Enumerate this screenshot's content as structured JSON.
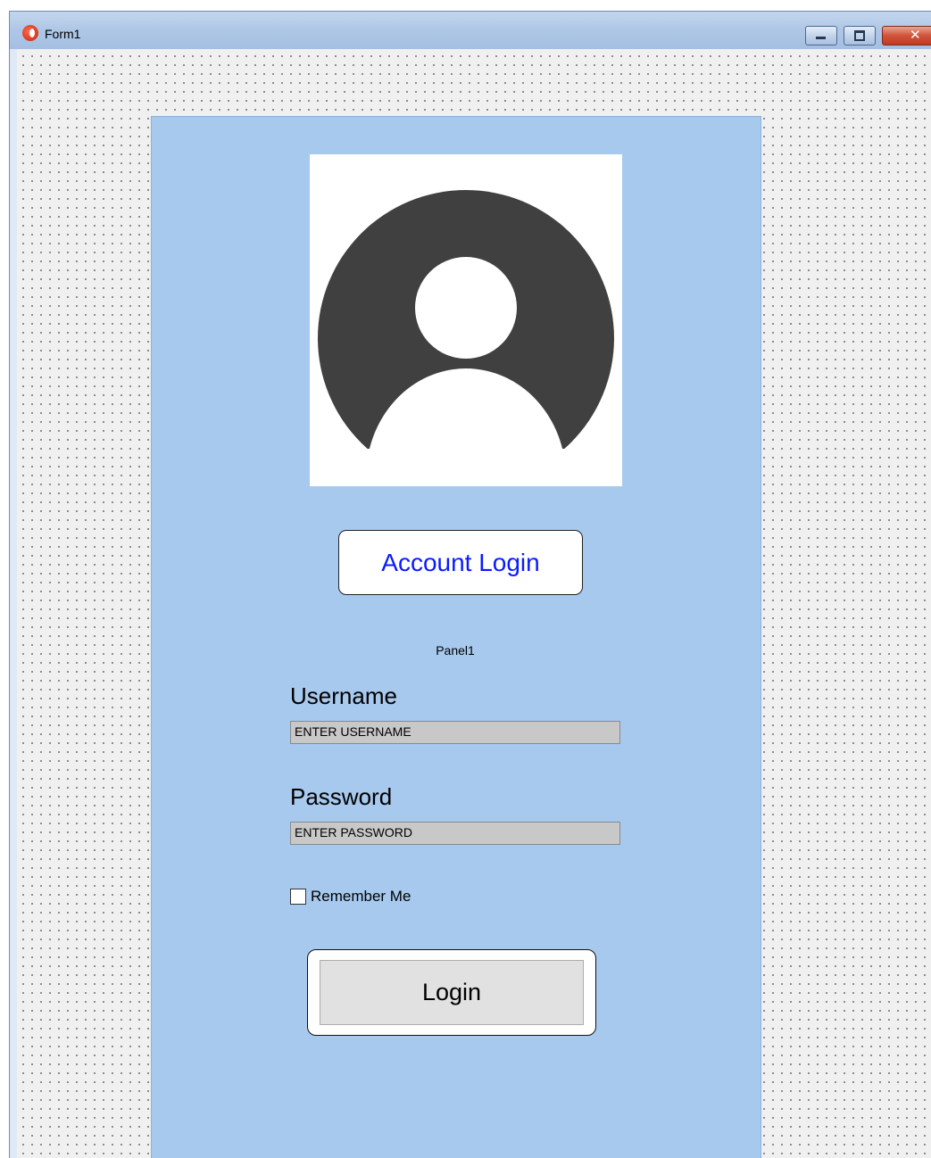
{
  "window": {
    "title": "Form1",
    "controls": [
      "minimize",
      "maximize",
      "close"
    ]
  },
  "panel": {
    "caption": "Panel1",
    "heading": "Account Login",
    "username_label": "Username",
    "username_value": "ENTER USERNAME",
    "password_label": "Password",
    "password_value": "ENTER PASSWORD",
    "remember_label": "Remember Me",
    "remember_checked": false,
    "login_label": "Login"
  },
  "colors": {
    "panel_bg": "#a7c9ee",
    "heading_text": "#0a1bff",
    "avatar": "#404040"
  },
  "icons": {
    "app": "app-icon",
    "avatar": "user-avatar-icon"
  }
}
